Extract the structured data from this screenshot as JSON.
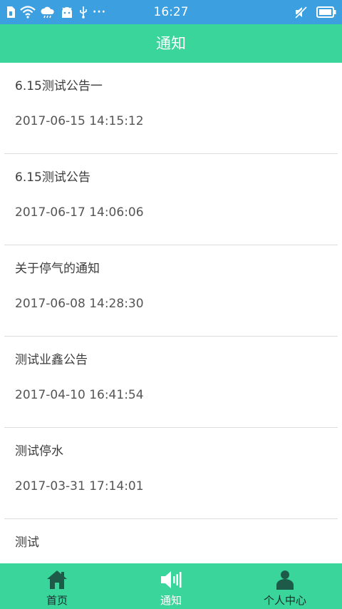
{
  "status_bar": {
    "time": "16:27",
    "more_indicator": "···",
    "icons": [
      "sim-icon",
      "wifi-icon",
      "cloud-icon",
      "android-icon",
      "usb-icon",
      "mute-icon",
      "battery-icon"
    ]
  },
  "header": {
    "title": "通知"
  },
  "notices": [
    {
      "title": "6.15测试公告一",
      "time": "2017-06-15 14:15:12"
    },
    {
      "title": "6.15测试公告",
      "time": "2017-06-17 14:06:06"
    },
    {
      "title": "关于停气的通知",
      "time": "2017-06-08 14:28:30"
    },
    {
      "title": "测试业鑫公告",
      "time": "2017-04-10 16:41:54"
    },
    {
      "title": "测试停水",
      "time": "2017-03-31 17:14:01"
    },
    {
      "title": "测试",
      "time": ""
    }
  ],
  "tab_bar": {
    "tabs": [
      {
        "label": "首页",
        "icon": "home-icon",
        "active": false
      },
      {
        "label": "通知",
        "icon": "speaker-icon",
        "active": true
      },
      {
        "label": "个人中心",
        "icon": "person-icon",
        "active": false
      }
    ]
  },
  "colors": {
    "status_bar": "#3b9fe0",
    "accent": "#3ad59b",
    "tab_icon_dark": "#1e5a48"
  }
}
